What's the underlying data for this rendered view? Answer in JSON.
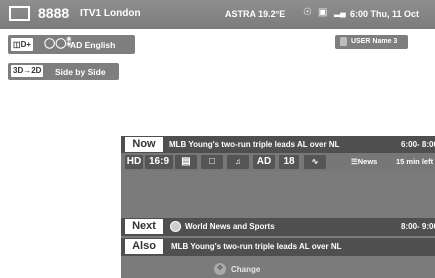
{
  "topbar": {
    "channel_number": "8888",
    "channel_name": "ITV1 London",
    "satellite": "ASTRA 19.2°E",
    "datetime": "6:00 Thu, 11 Oct",
    "icons": [
      "tv-icon",
      "signal-dish-icon",
      "lock-icon",
      "signal-strength-icon"
    ]
  },
  "audio": {
    "dolby_label": "D+",
    "description": "AD English"
  },
  "user": {
    "label": "USER Name 3"
  },
  "mode": {
    "tag": "3D→2D",
    "label": "Side by Side"
  },
  "now": {
    "tag": "Now",
    "title": "MLB Young's two-run triple leads AL over NL",
    "time": "6:00- 8:00",
    "badges": [
      "HD",
      "16:9",
      "",
      "",
      "",
      "AD",
      "18",
      ""
    ],
    "genre": "News",
    "remaining": "15 min left"
  },
  "next": {
    "tag": "Next",
    "title": "World News and Sports",
    "time": "8:00- 9:00"
  },
  "also": {
    "tag": "Also",
    "title": "MLB Young's two-run triple leads AL over NL"
  },
  "change": {
    "label": "Change"
  },
  "colors": {
    "bar": "#7b7b7b",
    "row": "#4f4f4f",
    "tag_bg": "#ffffff"
  }
}
